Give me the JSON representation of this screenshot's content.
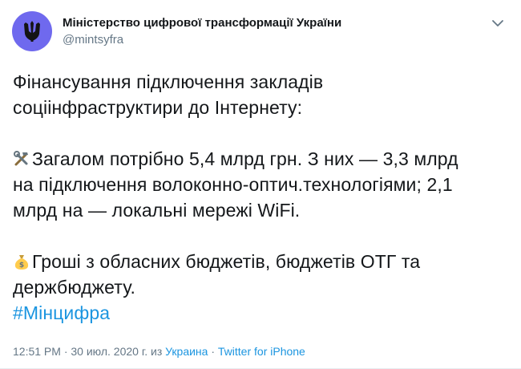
{
  "author": {
    "display_name": "Міністерство цифрової трансформації України",
    "handle": "@mintsyfra",
    "avatar_color": "#6f69ee",
    "avatar_icon": "trident-icon"
  },
  "menu_icon": "chevron-down-icon",
  "tweet": {
    "line1": "Фінансування підключення закладів",
    "line2": "соціінфраструктири до Інтернету:",
    "para2_emoji": "hammer-and-wrench-icon",
    "para2_line1": "Загалом потрібно 5,4 млрд грн. З них — 3,3 млрд",
    "para2_line2": "на підключення волоконно-оптич.технологіями; 2,1",
    "para2_line3": "млрд на — локальні мережі WiFi.",
    "para3_emoji": "money-bag-icon",
    "para3_line1": "Гроші з обласних бюджетів, бюджетів ОТГ та",
    "para3_line2": "держбюджету.",
    "hashtag": "#Мінцифра"
  },
  "meta": {
    "time_date": "12:51 PM · 30 июл. 2020 г. из ",
    "location": "Украина",
    "separator": " · ",
    "source": "Twitter for iPhone"
  },
  "colors": {
    "link": "#1b95e0",
    "secondary_text": "#657786",
    "primary_text": "#14171a"
  }
}
